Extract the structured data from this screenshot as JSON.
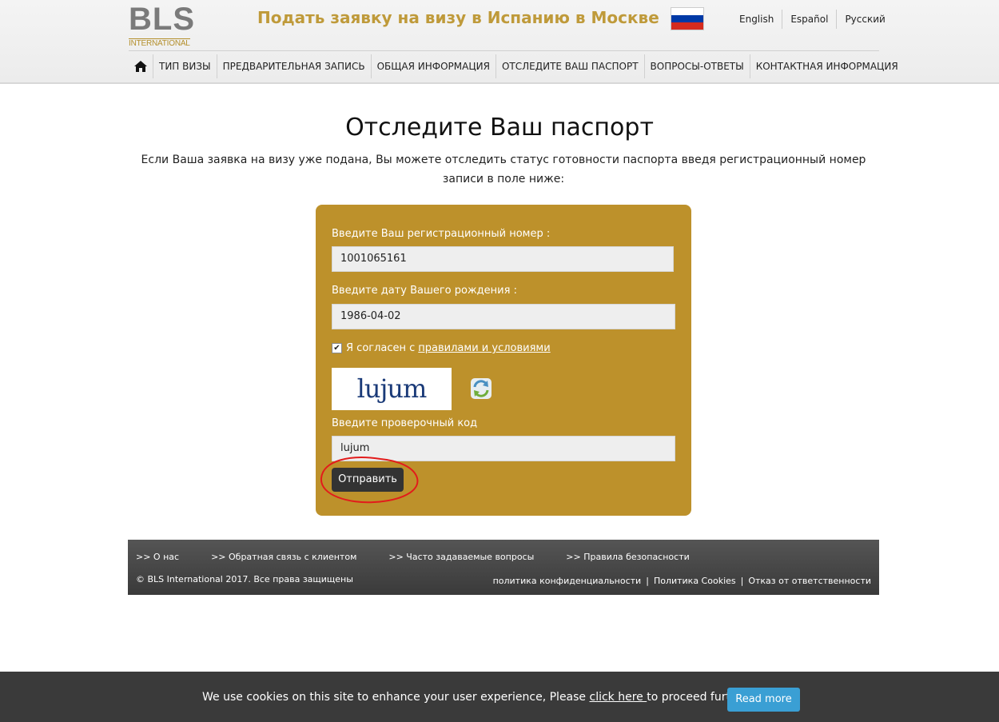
{
  "header": {
    "logo_main": "BLS",
    "logo_sub": "INTERNATIONAL",
    "title": "Подать заявку на визу в Испанию в Москве",
    "flag_colors": [
      "#ffffff",
      "#0039a6",
      "#d52b1e"
    ],
    "languages": [
      "English",
      "Español",
      "Русский"
    ]
  },
  "nav": {
    "home_icon": "home-icon",
    "items": [
      "ТИП ВИЗЫ",
      "ПРЕДВАРИТЕЛЬНАЯ ЗАПИСЬ",
      "ОБЩАЯ ИНФОРМАЦИЯ",
      "ОТСЛЕДИТЕ ВАШ ПАСПОРТ",
      "ВОПРОСЫ-ОТВЕТЫ",
      "КОНТАКТНАЯ ИНФОРМАЦИЯ"
    ]
  },
  "main": {
    "title": "Отследите Ваш паспорт",
    "intro": "Если Ваша заявка на визу уже подана, Вы можете отследить статус готовности паспорта введя регистрационный номер записи в поле ниже:"
  },
  "form": {
    "reg_label": "Введите Ваш регистрационный номер :",
    "reg_value": "1001065161",
    "dob_label": "Введите дату Вашего рождения :",
    "dob_value": "1986-04-02",
    "agree_prefix": "Я согласен с",
    "agree_link": "правилами и условиями",
    "agree_checked": true,
    "captcha_text": "lujum",
    "captcha_label": "Введите проверочный код",
    "captcha_value": "lujum",
    "submit_label": "Отправить",
    "box_color": "#bd912b"
  },
  "footer": {
    "links": [
      ">> О нас",
      ">> Обратная связь с клиентом",
      ">> Часто задаваемые вопросы",
      ">> Правила безопасности"
    ],
    "copyright": "© BLS International 2017. Все права защищены",
    "legal": [
      "политика конфиденциальности",
      "Политика Cookies",
      "Отказ от ответственности"
    ]
  },
  "cookie": {
    "message_before": "We use cookies on this site to enhance your user experience, Please ",
    "link": "click here ",
    "message_after": "to proceed further.",
    "button": "Read more",
    "button_color": "#3a9fd4"
  }
}
